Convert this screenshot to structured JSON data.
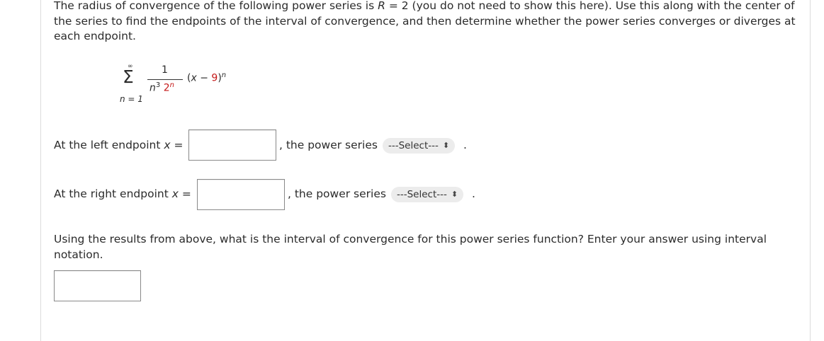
{
  "intro": {
    "text_before_R": "The radius of convergence of the following power series is ",
    "R_symbol": "R",
    "text_after_R": " = 2 (you do not need to show this here). Use this along with the center of the series to find the endpoints of the interval of convergence, and then determine whether the power series converges or diverges at each endpoint."
  },
  "formula": {
    "sum_top": "∞",
    "sigma": "Σ",
    "sum_bottom": "n = 1",
    "numerator": "1",
    "den_n": "n",
    "den_n_exp": "3",
    "den_two": "2",
    "den_two_exp": "n",
    "term_base": "(x − 9)",
    "term_exp": "n"
  },
  "left_row": {
    "label_prefix": "At the left endpoint ",
    "var": "x",
    "label_suffix": " =",
    "input_value": "",
    "comma_text": ", the power series",
    "select_value": "---Select---",
    "end": "."
  },
  "right_row": {
    "label_prefix": "At the right endpoint ",
    "var": "x",
    "label_suffix": " =",
    "input_value": "",
    "comma_text": ", the power series",
    "select_value": "---Select---",
    "end": "."
  },
  "question2": {
    "text": "Using the results from above, what is the interval of convergence for this power series function? Enter your answer using interval notation.",
    "input_value": ""
  },
  "icons": {
    "select_chevron": "updown-chevron-icon"
  }
}
